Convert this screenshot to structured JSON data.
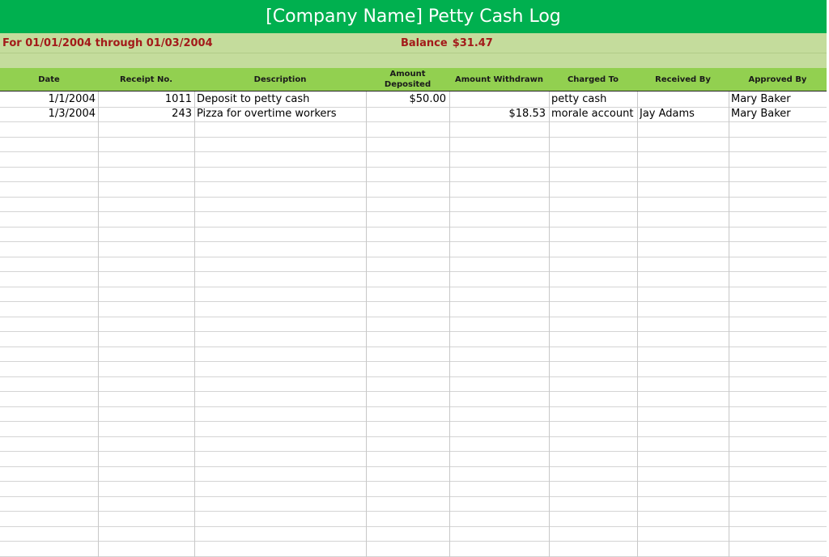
{
  "sheet": {
    "title": "[Company Name] Petty Cash Log",
    "period": "For 01/01/2004 through 01/03/2004",
    "balance_label": "Balance",
    "balance_value": "$31.47"
  },
  "columns": [
    {
      "key": "date",
      "label": "Date"
    },
    {
      "key": "receipt_no",
      "label": "Receipt No."
    },
    {
      "key": "description",
      "label": "Description"
    },
    {
      "key": "amount_deposited",
      "label": "Amount Deposited"
    },
    {
      "key": "amount_withdrawn",
      "label": "Amount Withdrawn"
    },
    {
      "key": "charged_to",
      "label": "Charged To"
    },
    {
      "key": "received_by",
      "label": "Received By"
    },
    {
      "key": "approved_by",
      "label": "Approved By"
    }
  ],
  "rows": [
    {
      "date": "1/1/2004",
      "receipt_no": "1011",
      "description": "Deposit to petty cash",
      "amount_deposited": "$50.00",
      "amount_withdrawn": "",
      "charged_to": "petty cash",
      "received_by": "",
      "approved_by": "Mary Baker"
    },
    {
      "date": "1/3/2004",
      "receipt_no": "243",
      "description": "Pizza for overtime workers",
      "amount_deposited": "",
      "amount_withdrawn": "$18.53",
      "charged_to": "morale account",
      "received_by": "Jay Adams",
      "approved_by": "Mary Baker"
    }
  ],
  "colors": {
    "title_bg": "#00b04f",
    "info_bg": "#c4dc9c",
    "header_bg": "#92d050",
    "accent_text": "#a31a1a"
  }
}
